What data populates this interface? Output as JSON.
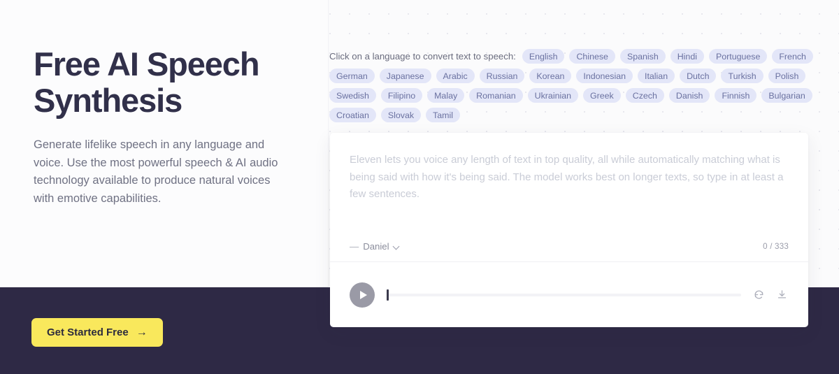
{
  "hero": {
    "title": "Free AI Speech\nSynthesis",
    "subtitle": "Generate lifelike speech in any language and voice. Use the most powerful speech & AI audio technology available to produce natural voices with emotive capabilities."
  },
  "cta": {
    "label": "Get Started Free",
    "arrow": "→",
    "background": "#f9e85c",
    "text_color": "#2c2b3d"
  },
  "language_picker": {
    "prompt": "Click on a language to convert text to speech:",
    "chip_background": "#e3e6f8",
    "chip_text_color": "#6a71a0",
    "languages": [
      "English",
      "Chinese",
      "Spanish",
      "Hindi",
      "Portuguese",
      "French",
      "German",
      "Japanese",
      "Arabic",
      "Russian",
      "Korean",
      "Indonesian",
      "Italian",
      "Dutch",
      "Turkish",
      "Polish",
      "Swedish",
      "Filipino",
      "Malay",
      "Romanian",
      "Ukrainian",
      "Greek",
      "Czech",
      "Danish",
      "Finnish",
      "Bulgarian",
      "Croatian",
      "Slovak",
      "Tamil"
    ]
  },
  "tts_card": {
    "textarea": {
      "value": "",
      "placeholder": "Eleven lets you voice any length of text in top quality, all while automatically matching what is being said with how it's being said. The model works best on longer texts, so type in at least a few sentences."
    },
    "voice": {
      "dash": "—",
      "name": "Daniel"
    },
    "char_count": "0 / 333",
    "player": {
      "progress_percent": 0,
      "play_icon": "play-icon",
      "regenerate_icon": "refresh-icon",
      "download_icon": "download-icon"
    }
  },
  "theme": {
    "page_background": "#fbfbfc",
    "dark_band": "#2e2945",
    "heading_color": "#31304a",
    "body_text_color": "#6f7183"
  }
}
